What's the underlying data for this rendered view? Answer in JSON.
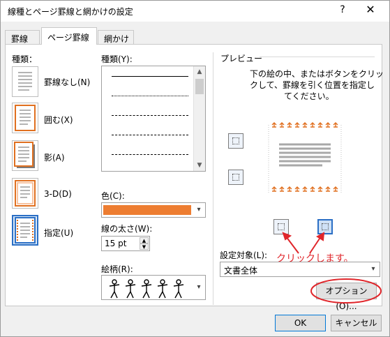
{
  "window": {
    "title": "線種とページ罫線と網かけの設定",
    "help": "?",
    "close": "✕"
  },
  "tabs": [
    {
      "label": "罫線"
    },
    {
      "label": "ページ罫線"
    },
    {
      "label": "網かけ"
    }
  ],
  "settings": {
    "heading": "種類：",
    "items": [
      {
        "label": "罫線なし(N)"
      },
      {
        "label": "囲む(X)"
      },
      {
        "label": "影(A)"
      },
      {
        "label": "3-D(D)"
      },
      {
        "label": "指定(U)"
      }
    ]
  },
  "style": {
    "label": "種類(Y):"
  },
  "color": {
    "label": "色(C):",
    "value": "#ed7d31"
  },
  "width": {
    "label": "線の太さ(W):",
    "value": "15 pt"
  },
  "art": {
    "label": "絵柄(R):"
  },
  "preview": {
    "heading": "プレビュー",
    "instruction_1": "下の絵の中、またはボタンをクリッ",
    "instruction_2": "クして、罫線を引く位置を指定し",
    "instruction_3": "てください。"
  },
  "apply_to": {
    "label": "設定対象(L):",
    "value": "文書全体"
  },
  "options_button": "オプション(O)...",
  "annotation": "クリックします。",
  "ok_button": "OK",
  "cancel_button": "キャンセル"
}
